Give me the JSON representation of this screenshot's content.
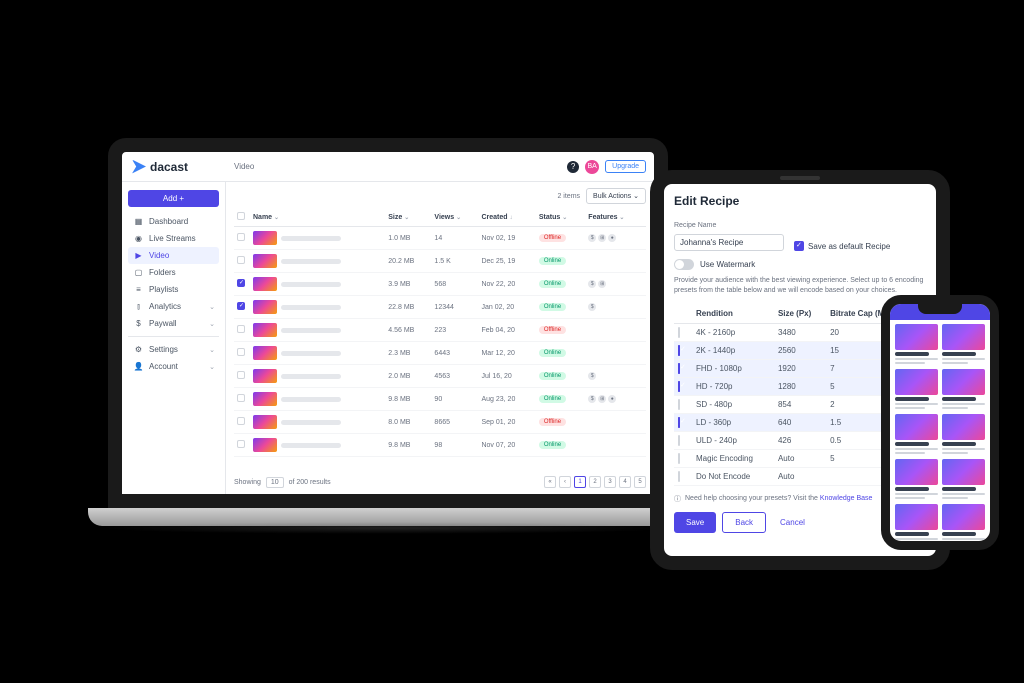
{
  "laptop": {
    "logo_text": "dacast",
    "breadcrumb": "Video",
    "avatar_initials": "BA",
    "upgrade_label": "Upgrade",
    "sidebar": {
      "add_label": "Add +",
      "items": [
        {
          "label": "Dashboard",
          "icon": "grid"
        },
        {
          "label": "Live Streams",
          "icon": "circle"
        },
        {
          "label": "Video",
          "icon": "play",
          "active": true
        },
        {
          "label": "Folders",
          "icon": "folder"
        },
        {
          "label": "Playlists",
          "icon": "list"
        },
        {
          "label": "Analytics",
          "icon": "bars",
          "expandable": true
        },
        {
          "label": "Paywall",
          "icon": "dollar",
          "expandable": true
        },
        {
          "label": "Settings",
          "icon": "gear",
          "expandable": true
        },
        {
          "label": "Account",
          "icon": "user",
          "expandable": true
        }
      ]
    },
    "toolbar": {
      "items_count": "2 items",
      "bulk_label": "Bulk Actions"
    },
    "columns": [
      "Name",
      "Size",
      "Views",
      "Created",
      "Status",
      "Features"
    ],
    "sort_column": "Created",
    "rows": [
      {
        "checked": false,
        "size": "1.0 MB",
        "views": "14",
        "created": "Nov 02, 19",
        "status": "Offline",
        "features": 3
      },
      {
        "checked": false,
        "size": "20.2 MB",
        "views": "1.5 K",
        "created": "Dec 25, 19",
        "status": "Online",
        "features": 0
      },
      {
        "checked": true,
        "size": "3.9 MB",
        "views": "568",
        "created": "Nov 22, 20",
        "status": "Online",
        "features": 2
      },
      {
        "checked": true,
        "size": "22.8 MB",
        "views": "12344",
        "created": "Jan 02, 20",
        "status": "Online",
        "features": 1
      },
      {
        "checked": false,
        "size": "4.56 MB",
        "views": "223",
        "created": "Feb 04, 20",
        "status": "Offline",
        "features": 0
      },
      {
        "checked": false,
        "size": "2.3 MB",
        "views": "6443",
        "created": "Mar 12, 20",
        "status": "Online",
        "features": 0
      },
      {
        "checked": false,
        "size": "2.0 MB",
        "views": "4563",
        "created": "Jul 16, 20",
        "status": "Online",
        "features": 1
      },
      {
        "checked": false,
        "size": "9.8 MB",
        "views": "90",
        "created": "Aug 23, 20",
        "status": "Online",
        "features": 3
      },
      {
        "checked": false,
        "size": "8.0 MB",
        "views": "8665",
        "created": "Sep 01, 20",
        "status": "Offline",
        "features": 0
      },
      {
        "checked": false,
        "size": "9.8 MB",
        "views": "98",
        "created": "Nov 07, 20",
        "status": "Online",
        "features": 0
      }
    ],
    "footer": {
      "showing_prefix": "Showing",
      "per_page": "10",
      "total_suffix": "of 200 results",
      "pages": [
        "1",
        "2",
        "3",
        "4",
        "5"
      ]
    }
  },
  "tablet": {
    "title": "Edit Recipe",
    "name_label": "Recipe Name",
    "name_value": "Johanna's Recipe",
    "default_label": "Save as default Recipe",
    "watermark_label": "Use Watermark",
    "help_text": "Provide your audience with the best viewing experience. Select up to 6 encoding presets from the table below and we will encode based on your choices.",
    "columns": [
      "Rendition",
      "Size (Px)",
      "Bitrate Cap (Mbps)"
    ],
    "rows": [
      {
        "checked": false,
        "rendition": "4K - 2160p",
        "size": "3480",
        "bitrate": "20"
      },
      {
        "checked": true,
        "rendition": "2K - 1440p",
        "size": "2560",
        "bitrate": "15"
      },
      {
        "checked": true,
        "rendition": "FHD - 1080p",
        "size": "1920",
        "bitrate": "7"
      },
      {
        "checked": true,
        "rendition": "HD - 720p",
        "size": "1280",
        "bitrate": "5"
      },
      {
        "checked": false,
        "rendition": "SD - 480p",
        "size": "854",
        "bitrate": "2"
      },
      {
        "checked": true,
        "rendition": "LD - 360p",
        "size": "640",
        "bitrate": "1.5"
      },
      {
        "checked": false,
        "rendition": "ULD - 240p",
        "size": "426",
        "bitrate": "0.5"
      },
      {
        "checked": false,
        "rendition": "Magic Encoding",
        "size": "Auto",
        "bitrate": "5"
      },
      {
        "checked": false,
        "rendition": "Do Not Encode",
        "size": "Auto",
        "bitrate": ""
      }
    ],
    "info_prefix": "Need help choosing your presets? Visit the ",
    "info_link": "Knowledge Base",
    "save": "Save",
    "back": "Back",
    "cancel": "Cancel"
  }
}
